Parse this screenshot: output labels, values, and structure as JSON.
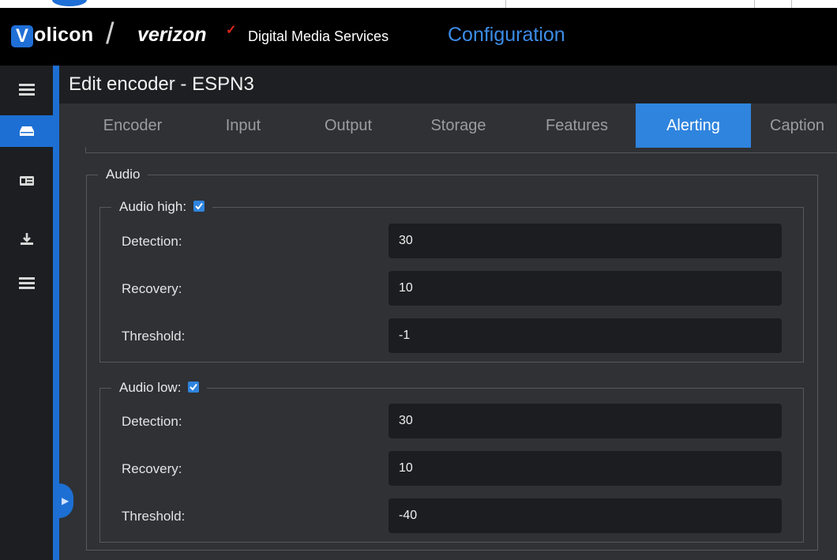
{
  "header": {
    "logo_v": "V",
    "logo_word": "olicon",
    "slash": "/",
    "verizon": "verizon",
    "verizon_check": "✓",
    "subtitle": "Digital Media Services",
    "section": "Configuration"
  },
  "rail": {
    "items": [
      {
        "icon": "hamburger-icon"
      },
      {
        "icon": "storage-drive-icon",
        "active": true
      },
      {
        "icon": "id-card-icon"
      },
      {
        "icon": "download-icon"
      },
      {
        "icon": "list-icon"
      }
    ],
    "collapse_icon": "chevron-right-icon"
  },
  "page_title": "Edit encoder - ESPN3",
  "tabs": [
    {
      "label": "Encoder"
    },
    {
      "label": "Input"
    },
    {
      "label": "Output"
    },
    {
      "label": "Storage"
    },
    {
      "label": "Features"
    },
    {
      "label": "Alerting",
      "active": true
    },
    {
      "label": "Caption"
    }
  ],
  "audio": {
    "legend": "Audio",
    "high": {
      "legend": "Audio high:",
      "checked": true,
      "detection_label": "Detection:",
      "detection_value": "30",
      "recovery_label": "Recovery:",
      "recovery_value": "10",
      "threshold_label": "Threshold:",
      "threshold_value": "-1"
    },
    "low": {
      "legend": "Audio low:",
      "checked": true,
      "detection_label": "Detection:",
      "detection_value": "30",
      "recovery_label": "Recovery:",
      "recovery_value": "10",
      "threshold_label": "Threshold:",
      "threshold_value": "-40"
    }
  },
  "colors": {
    "accent": "#2f84de",
    "rail_accent": "#1d6fd3",
    "header_bg": "#000000",
    "panel_bg": "#2f3135",
    "field_bg": "#1c1d20"
  }
}
